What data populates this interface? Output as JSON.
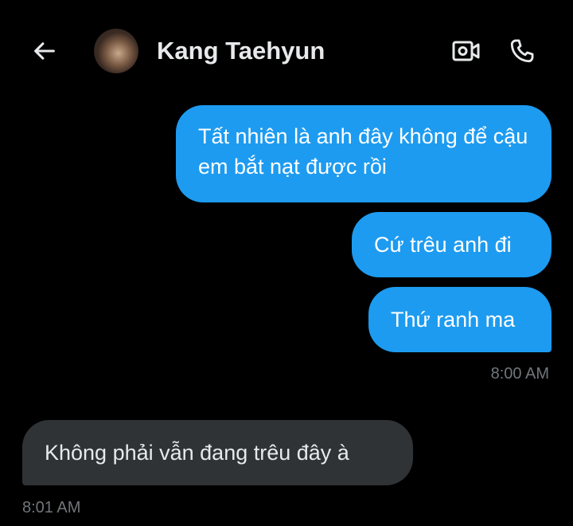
{
  "header": {
    "contact_name": "Kang Taehyun",
    "icons": {
      "back": "arrow-left-icon",
      "video": "video-camera-icon",
      "phone": "phone-icon"
    }
  },
  "messages": [
    {
      "direction": "sent",
      "text": "Tất nhiên là anh đây không để cậu em bắt nạt được rồi"
    },
    {
      "direction": "sent",
      "text": "Cứ trêu anh đi"
    },
    {
      "direction": "sent",
      "text": "Thứ ranh ma"
    },
    {
      "direction": "received",
      "text": "Không phải vẫn đang trêu đây à"
    }
  ],
  "timestamps": {
    "sent_group": "8:00 AM",
    "received_group": "8:01 AM"
  },
  "colors": {
    "background": "#000000",
    "sent_bubble": "#1d9bf0",
    "received_bubble": "#2f3336",
    "timestamp_text": "#71767b"
  }
}
